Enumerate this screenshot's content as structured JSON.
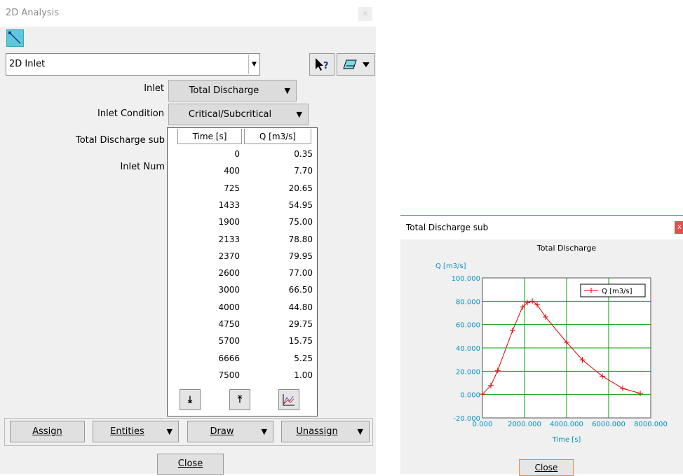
{
  "left_window": {
    "title": "2D Analysis",
    "close_glyph": "×",
    "combo_value": "2D Inlet",
    "help_icon": "pointer-help-icon",
    "layer_icon": "layer-dropdown-icon",
    "fields": {
      "inlet_label": "Inlet",
      "inlet_value": "Total Discharge",
      "condition_label": "Inlet Condition",
      "condition_value": "Critical/Subcritical",
      "discharge_label": "Total Discharge sub",
      "num_label": "Inlet Num"
    },
    "table": {
      "headers": [
        "Time [s]",
        "Q [m3/s]"
      ],
      "rows": [
        [
          "0",
          "0.35"
        ],
        [
          "400",
          "7.70"
        ],
        [
          "725",
          "20.65"
        ],
        [
          "1433",
          "54.95"
        ],
        [
          "1900",
          "75.00"
        ],
        [
          "2133",
          "78.80"
        ],
        [
          "2370",
          "79.95"
        ],
        [
          "2600",
          "77.00"
        ],
        [
          "3000",
          "66.50"
        ],
        [
          "4000",
          "44.80"
        ],
        [
          "4750",
          "29.75"
        ],
        [
          "5700",
          "15.75"
        ],
        [
          "6666",
          "5.25"
        ],
        [
          "7500",
          "1.00"
        ]
      ]
    },
    "buttons": {
      "assign": "Assign",
      "entities": "Entities",
      "draw": "Draw",
      "unassign": "Unassign",
      "close": "Close"
    }
  },
  "right_window": {
    "title": "Total Discharge sub",
    "close_label": "Close"
  },
  "chart_data": {
    "type": "line",
    "title": "Total Discharge",
    "xlabel": "Time [s]",
    "ylabel": "Q [m3/s]",
    "xlim": [
      0,
      8000
    ],
    "ylim": [
      -20,
      100
    ],
    "x_ticks": [
      "0.000",
      "2000.000",
      "4000.000",
      "6000.000",
      "8000.000"
    ],
    "y_ticks": [
      "100.000",
      "80.000",
      "60.000",
      "40.000",
      "20.000",
      "0.000",
      "-20.000"
    ],
    "grid": true,
    "legend_position": "top-right",
    "series": [
      {
        "name": "Q [m3/s]",
        "color": "#e00000",
        "x": [
          0,
          400,
          725,
          1433,
          1900,
          2133,
          2370,
          2600,
          3000,
          4000,
          4750,
          5700,
          6666,
          7500
        ],
        "y": [
          0.35,
          7.7,
          20.65,
          54.95,
          75.0,
          78.8,
          79.95,
          77.0,
          66.5,
          44.8,
          29.75,
          15.75,
          5.25,
          1.0
        ]
      }
    ],
    "colors": {
      "axis_text": "#0090c0",
      "grid": "#00a000",
      "line": "#e00000"
    }
  }
}
